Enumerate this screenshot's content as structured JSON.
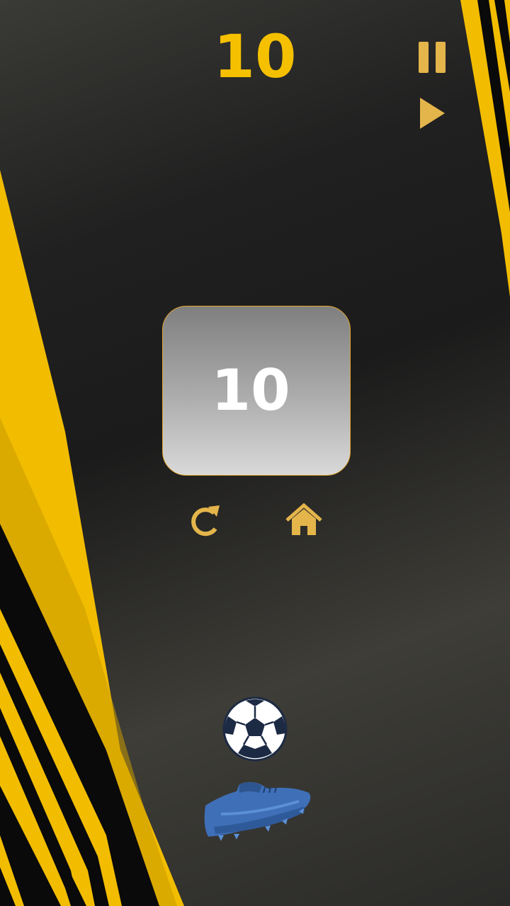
{
  "hud": {
    "score": "10",
    "pause_icon": "pause-icon",
    "play_icon": "play-icon"
  },
  "result": {
    "score": "10",
    "restart_icon": "restart-icon",
    "home_icon": "home-icon"
  },
  "player": {
    "ball_icon": "soccer-ball-icon",
    "shoe_icon": "football-boot-icon"
  },
  "colors": {
    "accent": "#f5c000",
    "icon": "#e4b54b",
    "card_border": "#e1a52d",
    "shoe": "#3f6fb7"
  }
}
